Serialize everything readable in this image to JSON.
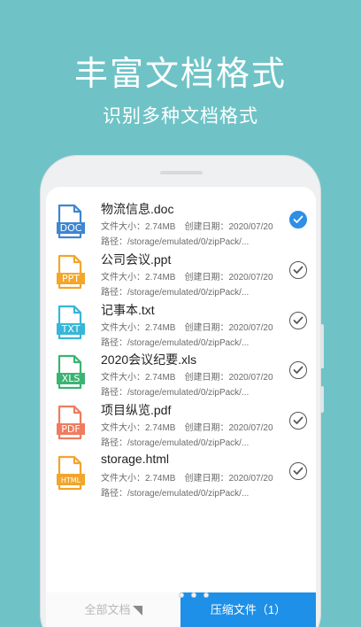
{
  "promo": {
    "headline": "丰富文档格式",
    "subheadline": "识别多种文档格式"
  },
  "files": [
    {
      "name": "物流信息.doc",
      "ext": "DOC",
      "color": "#3f86cf",
      "size": "文件大小：2.74MB",
      "date": "创建日期：2020/07/20",
      "path": "路径：/storage/emulated/0/zipPack/...",
      "selected": true
    },
    {
      "name": "公司会议.ppt",
      "ext": "PPT",
      "color": "#f3a62a",
      "size": "文件大小：2.74MB",
      "date": "创建日期：2020/07/20",
      "path": "路径：/storage/emulated/0/zipPack/...",
      "selected": false
    },
    {
      "name": "记事本.txt",
      "ext": "TXT",
      "color": "#38b6d8",
      "size": "文件大小：2.74MB",
      "date": "创建日期：2020/07/20",
      "path": "路径：/storage/emulated/0/zipPack/...",
      "selected": false
    },
    {
      "name": "2020会议纪要.xls",
      "ext": "XLS",
      "color": "#3cb374",
      "size": "文件大小：2.74MB",
      "date": "创建日期：2020/07/20",
      "path": "路径：/storage/emulated/0/zipPack/...",
      "selected": false
    },
    {
      "name": "项目纵览.pdf",
      "ext": "PDF",
      "color": "#ef7b60",
      "size": "文件大小：2.74MB",
      "date": "创建日期：2020/07/20",
      "path": "路径：/storage/emulated/0/zipPack/...",
      "selected": false
    },
    {
      "name": "storage.html",
      "ext": "HTML",
      "color": "#f2a52c",
      "size": "文件大小：2.74MB",
      "date": "创建日期：2020/07/20",
      "path": "路径：/storage/emulated/0/zipPack/...",
      "selected": false
    }
  ],
  "bottom_bar": {
    "all_docs_label": "全部文档",
    "compress_label": "压缩文件（1）"
  },
  "colors": {
    "background": "#6fc3c6",
    "accent": "#1e90e8"
  }
}
